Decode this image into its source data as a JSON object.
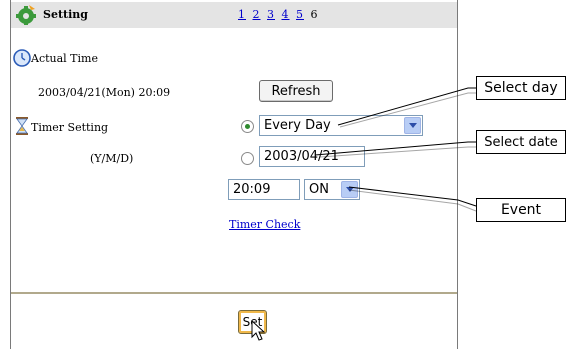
{
  "header": {
    "title": "Setting",
    "pages": [
      "1",
      "2",
      "3",
      "4",
      "5"
    ],
    "current_page": "6"
  },
  "actual_time": {
    "label": "Actual Time",
    "value": "2003/04/21(Mon) 20:09",
    "refresh_label": "Refresh"
  },
  "timer": {
    "label": "Timer Setting",
    "date_format": "(Y/M/D)",
    "day_option": "Every Day",
    "date_value": "2003/04/21",
    "time_value": "20:09",
    "event_value": "ON",
    "check_link": "Timer Check"
  },
  "set_label": "Set",
  "callouts": {
    "select_day": "Select day",
    "select_date": "Select date",
    "event": "Event"
  },
  "icons": [
    "gear-icon",
    "clock-icon",
    "hourglass-icon",
    "cursor-icon"
  ]
}
